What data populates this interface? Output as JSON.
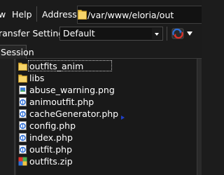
{
  "menubar": {
    "view_label": "w",
    "help_label": "Help",
    "address_label": "Address",
    "address_value": "/var/www/eloria/out"
  },
  "toolbar": {
    "transfer_label": "ransfer Settings",
    "transfer_value": "Default"
  },
  "tabs": [
    {
      "label": "Session"
    }
  ],
  "files": [
    {
      "name": "outfits_anim",
      "type": "folder",
      "icon": "folder-icon"
    },
    {
      "name": "libs",
      "type": "folder",
      "icon": "folder-icon"
    },
    {
      "name": "abuse_warning.png",
      "type": "image",
      "icon": "png-file-icon"
    },
    {
      "name": "animoutfit.php",
      "type": "php",
      "icon": "php-file-icon"
    },
    {
      "name": "cacheGenerator.php",
      "type": "php",
      "icon": "php-file-icon"
    },
    {
      "name": "config.php",
      "type": "php",
      "icon": "php-file-icon"
    },
    {
      "name": "index.php",
      "type": "php",
      "icon": "php-file-icon"
    },
    {
      "name": "outfit.php",
      "type": "php",
      "icon": "php-file-icon"
    },
    {
      "name": "outfits.zip",
      "type": "archive",
      "icon": "zip-archive-icon"
    }
  ],
  "colors": {
    "background": "#1e1e1e",
    "folder": "#f0c442",
    "php_icon": "#2f6fd6",
    "sync_red": "#e0322a",
    "sync_blue": "#2f6fd6"
  }
}
